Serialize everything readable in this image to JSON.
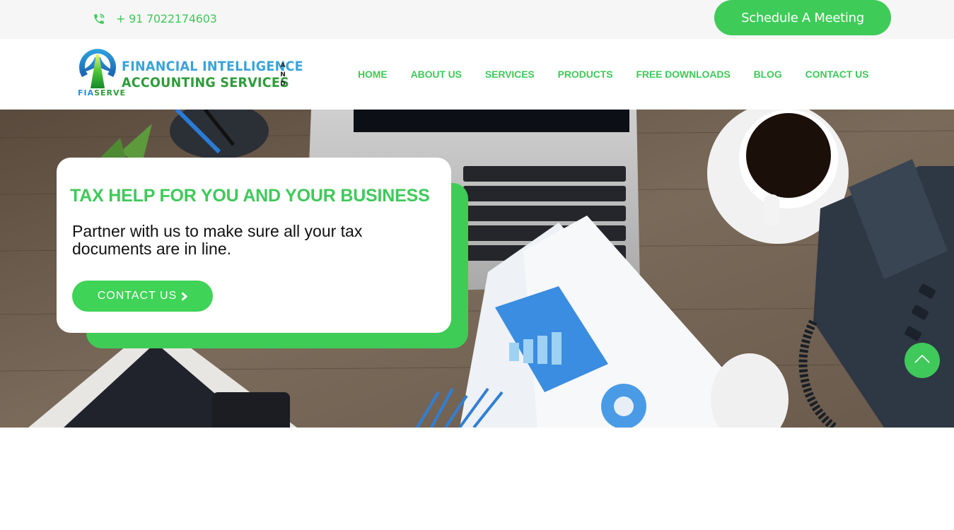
{
  "topbar": {
    "phone_icon": "phone-ringing-icon",
    "phone": "+ 91 7022174603",
    "schedule_label": "Schedule A Meeting"
  },
  "logo": {
    "line1": "FINANCIAL INTELLIGENCE",
    "line2": "ACCOUNTING SERVICES",
    "and_text": "AND",
    "sub_a": "FIA",
    "sub_b": "SERVE"
  },
  "nav": {
    "items": [
      {
        "label": "HOME"
      },
      {
        "label": "ABOUT US"
      },
      {
        "label": "SERVICES"
      },
      {
        "label": "PRODUCTS"
      },
      {
        "label": "FREE DOWNLOADS"
      },
      {
        "label": "BLOG"
      },
      {
        "label": "CONTACT US"
      }
    ]
  },
  "hero": {
    "title": "TAX HELP FOR YOU AND YOUR BUSINESS",
    "text": "Partner with us to make sure all your tax documents are in line.",
    "button_label": "CONTACT US",
    "button_icon": "chevron-right-icon",
    "scroll_top_icon": "chevron-up-icon"
  },
  "colors": {
    "brand_green": "#3fc95a",
    "topbar_bg": "#f6f6f6",
    "logo_blue": "#3aa3d9",
    "logo_green": "#2e9c3a"
  }
}
